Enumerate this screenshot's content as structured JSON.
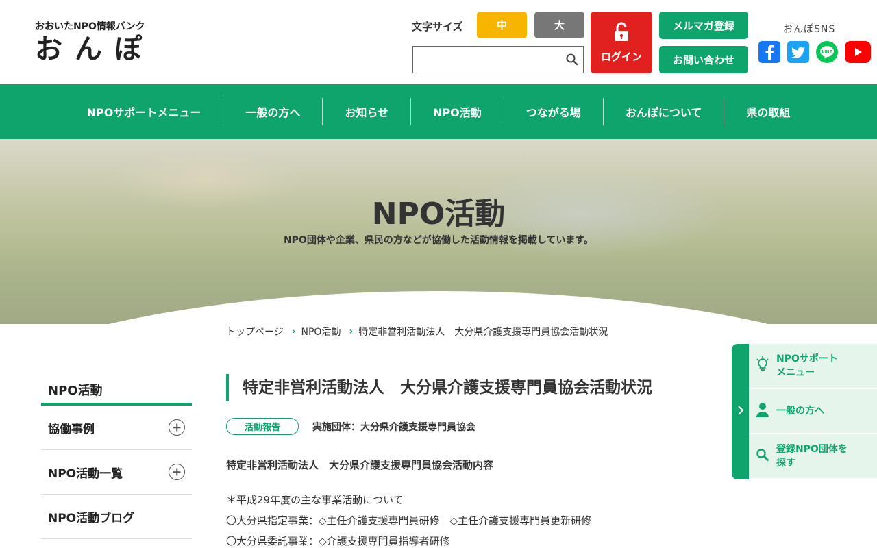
{
  "header": {
    "logo_sub": "おおいたNPO情報バンク",
    "logo_main": "おんぽ",
    "font_size_label": "文字サイズ",
    "font_size_mid": "中",
    "font_size_large": "大",
    "search_placeholder": "",
    "login_label": "ログイン",
    "magazine_label": "メルマガ登録",
    "contact_label": "お問い合わせ",
    "sns_label": "おんぽSNS",
    "sns_icons": [
      "facebook-icon",
      "twitter-icon",
      "line-icon",
      "youtube-icon"
    ]
  },
  "nav": {
    "items": [
      "NPOサポートメニュー",
      "一般の方へ",
      "お知らせ",
      "NPO活動",
      "つながる場",
      "おんぽについて",
      "県の取組"
    ]
  },
  "hero": {
    "title": "NPO活動",
    "subtitle": "NPO団体や企業、県民の方などが協働した活動情報を掲載しています。"
  },
  "breadcrumb": {
    "items": [
      "トップページ",
      "NPO活動",
      "特定非営利活動法人　大分県介護支援専門員協会活動状況"
    ]
  },
  "sidebar": {
    "title": "NPO活動",
    "items": [
      "協働事例",
      "NPO活動一覧",
      "NPO活動ブログ"
    ]
  },
  "main": {
    "title": "特定非営利活動法人　大分県介護支援専門員協会活動状況",
    "tag": "活動報告",
    "org": "実施団体：大分県介護支援専門員協会",
    "subhead": "特定非営利活動法人　大分県介護支援専門員協会活動内容",
    "lines": [
      "＊平成29年度の主な事業活動について",
      "〇大分県指定事業：◇主任介護支援専門員研修　◇主任介護支援専門員更新研修",
      "〇大分県委託事業：◇介護支援専門員指導者研修"
    ]
  },
  "float_panel": {
    "items": [
      "NPOサポートメニュー",
      "一般の方へ",
      "登録NPO団体を探す"
    ],
    "items_line1": [
      "NPOサポート",
      "一般の方へ",
      "登録NPO団体を"
    ],
    "items_line2": [
      "メニュー",
      "",
      "探す"
    ]
  },
  "colors": {
    "brand_green": "#0fa46c",
    "font_mid": "#f7b500",
    "font_large": "#777777",
    "login_red": "#e12120",
    "panel_bg": "#e5f5ec"
  }
}
